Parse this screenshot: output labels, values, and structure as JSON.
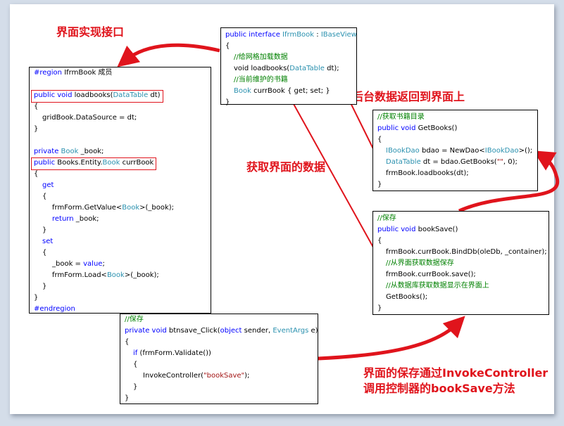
{
  "captions": {
    "ui_implements_interface": "界面实现接口",
    "backend_returns_data": "后台数据返回到界面上",
    "get_ui_data": "获取界面的数据",
    "save_via_controller_1": "界面的保存通过InvokeController",
    "save_via_controller_2": "调用控制器的bookSave方法"
  },
  "interface_box": {
    "line1_kw": "public interface ",
    "line1_type": "IfrmBook",
    "line1_colon": " : ",
    "line1_base": "IBaseView",
    "brace_open": "{",
    "comment1": "//给网格加载数据",
    "method_pre": "void loadbooks(",
    "method_type": "DataTable",
    "method_post": " dt);",
    "comment2": "//当前维护的书籍",
    "prop_type": "Book",
    "prop_rest": " currBook { get; set; }",
    "brace_close": "}"
  },
  "region_box": {
    "region_kw": "#region",
    "region_name": " IfrmBook 成员",
    "method_kw": "public void",
    "method_name": " loadbooks(",
    "method_type": "DataTable",
    "method_post": " dt)",
    "brace_open": "{",
    "body": "gridBook.DataSource = dt;",
    "brace_close": "}",
    "field_kw": "private ",
    "field_type": "Book",
    "field_name": " _book;",
    "prop_kw": "public",
    "prop_mid": " Books.Entity.",
    "prop_type": "Book",
    "prop_name": " currBook",
    "get_kw": "get",
    "get_body_pre": "frmForm.GetValue<",
    "get_body_type": "Book",
    "get_body_post": ">(_book);",
    "return_kw": "return",
    "return_rest": " _book;",
    "set_kw": "set",
    "set_body_pre": "_book = ",
    "set_body_kw": "value",
    "set_body_post": ";",
    "load_pre": "frmForm.Load<",
    "load_type": "Book",
    "load_post": ">(_book);",
    "endregion_kw": "#endregion"
  },
  "getbooks_box": {
    "comment": "//获取书籍目录",
    "sig_kw": "public void",
    "sig_rest": " GetBooks()",
    "brace_open": "{",
    "l1_type": "IBookDao",
    "l1_mid": " bdao = NewDao<",
    "l1_type2": "IBookDao",
    "l1_post": ">();",
    "l2_type": "DataTable",
    "l2_mid": " dt = bdao.GetBooks(",
    "l2_str": "\"\"",
    "l2_post": ", 0);",
    "l3": "frmBook.loadbooks(dt);",
    "brace_close": "}"
  },
  "booksave_box": {
    "comment": "//保存",
    "sig_kw": "public void",
    "sig_rest": " bookSave()",
    "brace_open": "{",
    "l1": "frmBook.currBook.BindDb(oleDb, _container);",
    "comment2": "//从界面获取数据保存",
    "l2": "frmBook.currBook.save();",
    "comment3": "//从数据库获取数据显示在界面上",
    "l3": "GetBooks();",
    "brace_close": "}"
  },
  "btnsave_box": {
    "comment": "//保存",
    "sig_kw": "private void",
    "sig_mid": " btnsave_Click(",
    "sig_kw2": "object",
    "sig_mid2": " sender, ",
    "sig_type": "EventArgs",
    "sig_post": " e)",
    "brace_open": "{",
    "if_kw": "if",
    "if_rest": " (frmForm.Validate())",
    "brace_open2": "{",
    "invoke_pre": "InvokeController(",
    "invoke_str": "\"bookSave\"",
    "invoke_post": ");",
    "brace_close2": "}",
    "brace_close": "}"
  },
  "colors": {
    "arrow_red": "#e0141c",
    "keyword_blue": "#0000ff",
    "type_teal": "#2b91af",
    "comment_green": "#008000",
    "string_red": "#a31515"
  }
}
